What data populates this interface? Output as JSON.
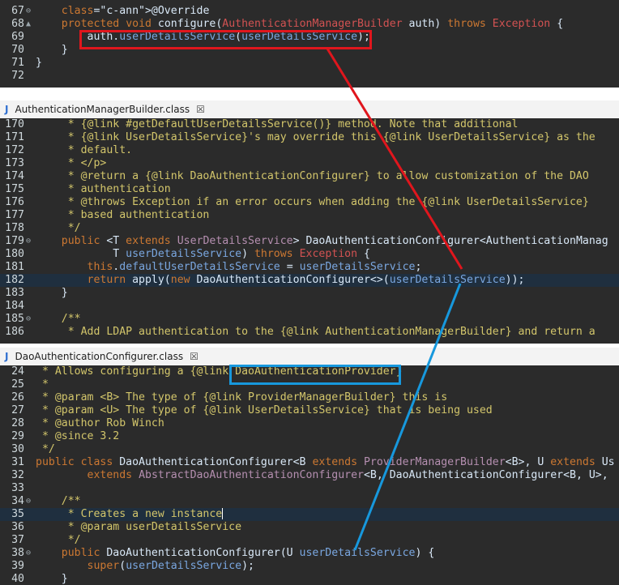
{
  "colors": {
    "editor_bg": "#2b2b2b",
    "keyword": "#cc7832",
    "annotation": "#bbb529",
    "type": "#b58fb0",
    "variable": "#7aa7e0",
    "comment": "#d3c66b",
    "red_annotation": "#e0161d",
    "blue_annotation": "#1798dd"
  },
  "pane1": {
    "lines": [
      {
        "n": "67",
        "fold": "⊖",
        "code": "    @Override"
      },
      {
        "n": "68",
        "fold": "▲",
        "code": "    protected void configure(AuthenticationManagerBuilder auth) throws Exception {"
      },
      {
        "n": "69",
        "fold": "",
        "code": "        auth.userDetailsService(userDetailsService);"
      },
      {
        "n": "70",
        "fold": "",
        "code": "    }"
      },
      {
        "n": "71",
        "fold": "",
        "code": "}"
      },
      {
        "n": "72",
        "fold": "",
        "code": ""
      }
    ]
  },
  "pane2": {
    "tab_icon": "J",
    "tab_title": "AuthenticationManagerBuilder.class",
    "tab_close": "☒",
    "lines": [
      {
        "n": "170",
        "fold": "",
        "code": "     * {@link #getDefaultUserDetailsService()} method. Note that additional"
      },
      {
        "n": "171",
        "fold": "",
        "code": "     * {@link UserDetailsService}'s may override this {@link UserDetailsService} as the"
      },
      {
        "n": "172",
        "fold": "",
        "code": "     * default."
      },
      {
        "n": "173",
        "fold": "",
        "code": "     * </p>"
      },
      {
        "n": "174",
        "fold": "",
        "code": "     * @return a {@link DaoAuthenticationConfigurer} to allow customization of the DAO"
      },
      {
        "n": "175",
        "fold": "",
        "code": "     * authentication"
      },
      {
        "n": "176",
        "fold": "",
        "code": "     * @throws Exception if an error occurs when adding the {@link UserDetailsService}"
      },
      {
        "n": "177",
        "fold": "",
        "code": "     * based authentication"
      },
      {
        "n": "178",
        "fold": "",
        "code": "     */"
      },
      {
        "n": "179",
        "fold": "⊖",
        "code": "    public <T extends UserDetailsService> DaoAuthenticationConfigurer<AuthenticationManag"
      },
      {
        "n": "180",
        "fold": "",
        "code": "            T userDetailsService) throws Exception {"
      },
      {
        "n": "181",
        "fold": "",
        "code": "        this.defaultUserDetailsService = userDetailsService;"
      },
      {
        "n": "182",
        "fold": "",
        "code": "        return apply(new DaoAuthenticationConfigurer<>(userDetailsService));"
      },
      {
        "n": "183",
        "fold": "",
        "code": "    }"
      },
      {
        "n": "184",
        "fold": "",
        "code": ""
      },
      {
        "n": "185",
        "fold": "⊖",
        "code": "    /**"
      },
      {
        "n": "186",
        "fold": "",
        "code": "     * Add LDAP authentication to the {@link AuthenticationManagerBuilder} and return a"
      }
    ]
  },
  "pane3": {
    "tab_icon": "J",
    "tab_title": "DaoAuthenticationConfigurer.class",
    "tab_close": "☒",
    "lines": [
      {
        "n": "24",
        "fold": "",
        "code": " * Allows configuring a {@link DaoAuthenticationProvider}"
      },
      {
        "n": "25",
        "fold": "",
        "code": " *"
      },
      {
        "n": "26",
        "fold": "",
        "code": " * @param <B> The type of {@link ProviderManagerBuilder} this is"
      },
      {
        "n": "27",
        "fold": "",
        "code": " * @param <U> The type of {@link UserDetailsService} that is being used"
      },
      {
        "n": "28",
        "fold": "",
        "code": " * @author Rob Winch"
      },
      {
        "n": "29",
        "fold": "",
        "code": " * @since 3.2"
      },
      {
        "n": "30",
        "fold": "",
        "code": " */"
      },
      {
        "n": "31",
        "fold": "",
        "code": "public class DaoAuthenticationConfigurer<B extends ProviderManagerBuilder<B>, U extends Us"
      },
      {
        "n": "32",
        "fold": "",
        "code": "        extends AbstractDaoAuthenticationConfigurer<B, DaoAuthenticationConfigurer<B, U>,"
      },
      {
        "n": "33",
        "fold": "",
        "code": ""
      },
      {
        "n": "34",
        "fold": "⊖",
        "code": "    /**"
      },
      {
        "n": "35",
        "fold": "",
        "code": "     * Creates a new instance"
      },
      {
        "n": "36",
        "fold": "",
        "code": "     * @param userDetailsService"
      },
      {
        "n": "37",
        "fold": "",
        "code": "     */"
      },
      {
        "n": "38",
        "fold": "⊖",
        "code": "    public DaoAuthenticationConfigurer(U userDetailsService) {"
      },
      {
        "n": "39",
        "fold": "",
        "code": "        super(userDetailsService);"
      },
      {
        "n": "40",
        "fold": "",
        "code": "    }"
      }
    ]
  }
}
